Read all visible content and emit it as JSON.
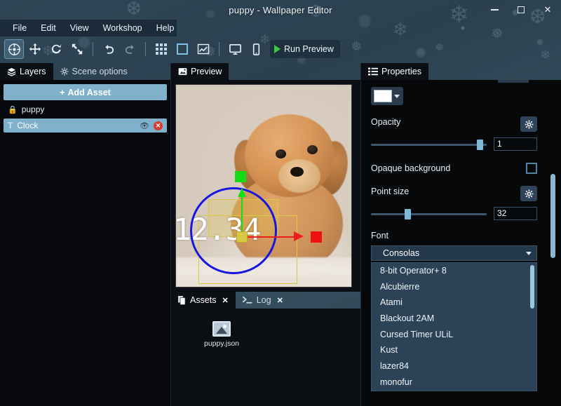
{
  "window": {
    "title": "puppy - Wallpaper Editor",
    "minimize_label": "–",
    "maximize_label": "□",
    "close_label": "✕"
  },
  "menubar": {
    "items": [
      {
        "label": "File"
      },
      {
        "label": "Edit"
      },
      {
        "label": "View"
      },
      {
        "label": "Workshop"
      },
      {
        "label": "Help"
      }
    ]
  },
  "toolbar": {
    "tools": [
      {
        "name": "select-tool",
        "glyph": "⨁"
      },
      {
        "name": "move-tool",
        "glyph": "✥"
      },
      {
        "name": "rotate-tool",
        "glyph": "⟳"
      },
      {
        "name": "scale-tool",
        "glyph": "⤡"
      },
      {
        "name": "undo",
        "glyph": "↶"
      },
      {
        "name": "redo",
        "glyph": "↷"
      },
      {
        "name": "grid-toggle",
        "glyph": "▦"
      },
      {
        "name": "bounds-toggle",
        "glyph": "▢"
      },
      {
        "name": "graph-toggle",
        "glyph": "↗"
      },
      {
        "name": "monitor-preview",
        "glyph": "▣"
      },
      {
        "name": "mobile-preview",
        "glyph": "▯"
      }
    ],
    "run_preview_label": "Run Preview"
  },
  "left_panel": {
    "tabs": [
      {
        "label": "Layers",
        "icon": "layers-icon",
        "active": true
      },
      {
        "label": "Scene options",
        "icon": "gear-icon",
        "active": false
      }
    ],
    "add_asset_label": "Add Asset",
    "add_asset_plus": "+",
    "layers": [
      {
        "label": "puppy",
        "icon": "lock-icon",
        "locked": true,
        "selected": false
      },
      {
        "label": "Clock",
        "icon": "text-icon",
        "locked": false,
        "selected": true,
        "eye_glyph": "◉",
        "delete_glyph": "✕"
      }
    ]
  },
  "center_panel": {
    "preview_tab": {
      "label": "Preview",
      "icon": "image-icon"
    },
    "clock_text": "12.34",
    "bottom_tabs": [
      {
        "label": "Assets",
        "icon": "files-icon",
        "close": "✕",
        "active": true
      },
      {
        "label": "Log",
        "icon": "terminal-icon",
        "close": "✕",
        "active": false
      }
    ],
    "assets": [
      {
        "label": "puppy.json",
        "icon": "image-file-icon"
      }
    ]
  },
  "right_panel": {
    "tab": {
      "label": "Properties",
      "icon": "list-icon"
    },
    "color": {
      "value": "#ffffff",
      "caret": "▾"
    },
    "opacity": {
      "label": "Opacity",
      "value": "1",
      "percent": 95,
      "gear": "⚙"
    },
    "opaque_background": {
      "label": "Opaque background",
      "checked": false
    },
    "point_size": {
      "label": "Point size",
      "value": "32",
      "percent": 32,
      "gear": "⚙"
    },
    "font": {
      "label": "Font",
      "selected": "Consolas",
      "caret": "▾",
      "options": [
        "8-bit Operator+ 8",
        "Alcubierre",
        "Atami",
        "Blackout 2AM",
        "Cursed Timer ULiL",
        "Kust",
        "lazer84",
        "monofur"
      ]
    }
  },
  "colors": {
    "accent": "#7fb0cc",
    "panel_bg": "#0b0e12",
    "title_bg": "#2e4555",
    "lock": "#f0a419",
    "delete": "#d63b32",
    "play": "#3ec93e",
    "gizmo_x": "#ef1e1e",
    "gizmo_y": "#12e012",
    "gizmo_rotate": "#1616e0",
    "gizmo_box": "#d8c843"
  }
}
